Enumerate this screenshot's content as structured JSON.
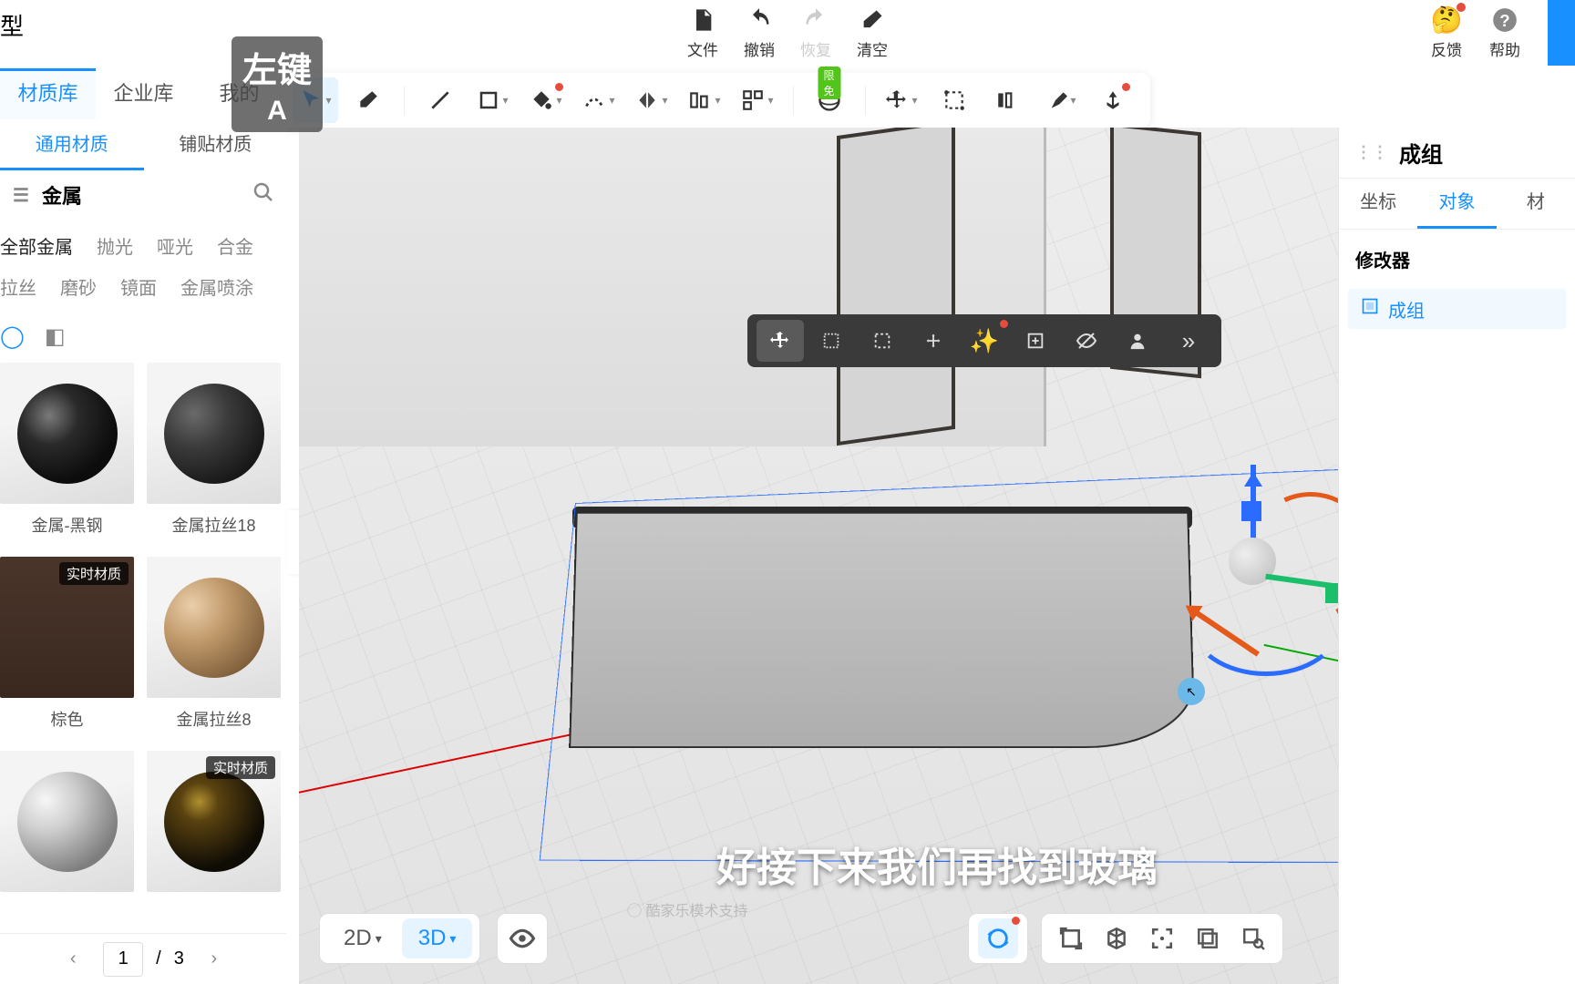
{
  "top_menu": {
    "file": "文件",
    "undo": "撤销",
    "redo": "恢复",
    "clear": "清空"
  },
  "top_right": {
    "feedback": "反馈",
    "help": "帮助"
  },
  "toolbar": {
    "badge_free": "限免"
  },
  "left": {
    "tabs": {
      "material_lib": "材质库",
      "enterprise_lib": "企业库",
      "mine": "我的"
    },
    "subtabs": {
      "general": "通用材质",
      "tile": "铺贴材质"
    },
    "category": "金属",
    "filters_row1": {
      "all": "全部金属",
      "polished": "抛光",
      "matte": "哑光",
      "alloy": "合金"
    },
    "filters_row2": {
      "brushed": "拉丝",
      "frosted": "磨砂",
      "mirror": "镜面",
      "spray": "金属喷涂"
    },
    "materials": [
      {
        "label": "金属-黑钢",
        "realtime": false,
        "sphere_css": "radial-gradient(circle at 32% 32%, #7a7a7a 0%, #2a2a2a 30%, #0c0c0c 70%)"
      },
      {
        "label": "金属拉丝18",
        "realtime": false,
        "sphere_css": "radial-gradient(circle at 30% 30%, #6a6a6a 0%, #3a3a3a 35%, #181818 75%)"
      },
      {
        "label": "棕色",
        "realtime": true,
        "sphere_css": "",
        "flat_css": "linear-gradient(#4a352a,#3a281f)"
      },
      {
        "label": "金属拉丝8",
        "realtime": false,
        "sphere_css": "radial-gradient(circle at 28% 28%, #eaceab 0%, #c19a6b 35%, #7d5d3a 80%)"
      },
      {
        "label": "",
        "realtime": false,
        "sphere_css": "radial-gradient(circle at 28% 28%, #f6f6f6 0%, #cfcfcf 30%, #7e7e7e 75%)"
      },
      {
        "label": "",
        "realtime": true,
        "sphere_css": "radial-gradient(circle at 35% 30%, #b09030 0%, #5a4210 20%, #0f0c05 70%)"
      }
    ],
    "pager": {
      "current": "1",
      "sep": "/",
      "total": "3"
    },
    "realtime_tag": "实时材质"
  },
  "float_toolbar": {
    "items": 9
  },
  "view_toggle": {
    "v2d": "2D",
    "v3d": "3D"
  },
  "right": {
    "title": "成组",
    "tabs": {
      "coord": "坐标",
      "object": "对象",
      "mat": "材"
    },
    "section": "修改器",
    "item": "成组"
  },
  "overlay": {
    "subtitle": "好接下来我们再找到玻璃",
    "key_main": "左键",
    "key_sub": "A",
    "watermark": "◯ 酷家乐模术支持"
  }
}
